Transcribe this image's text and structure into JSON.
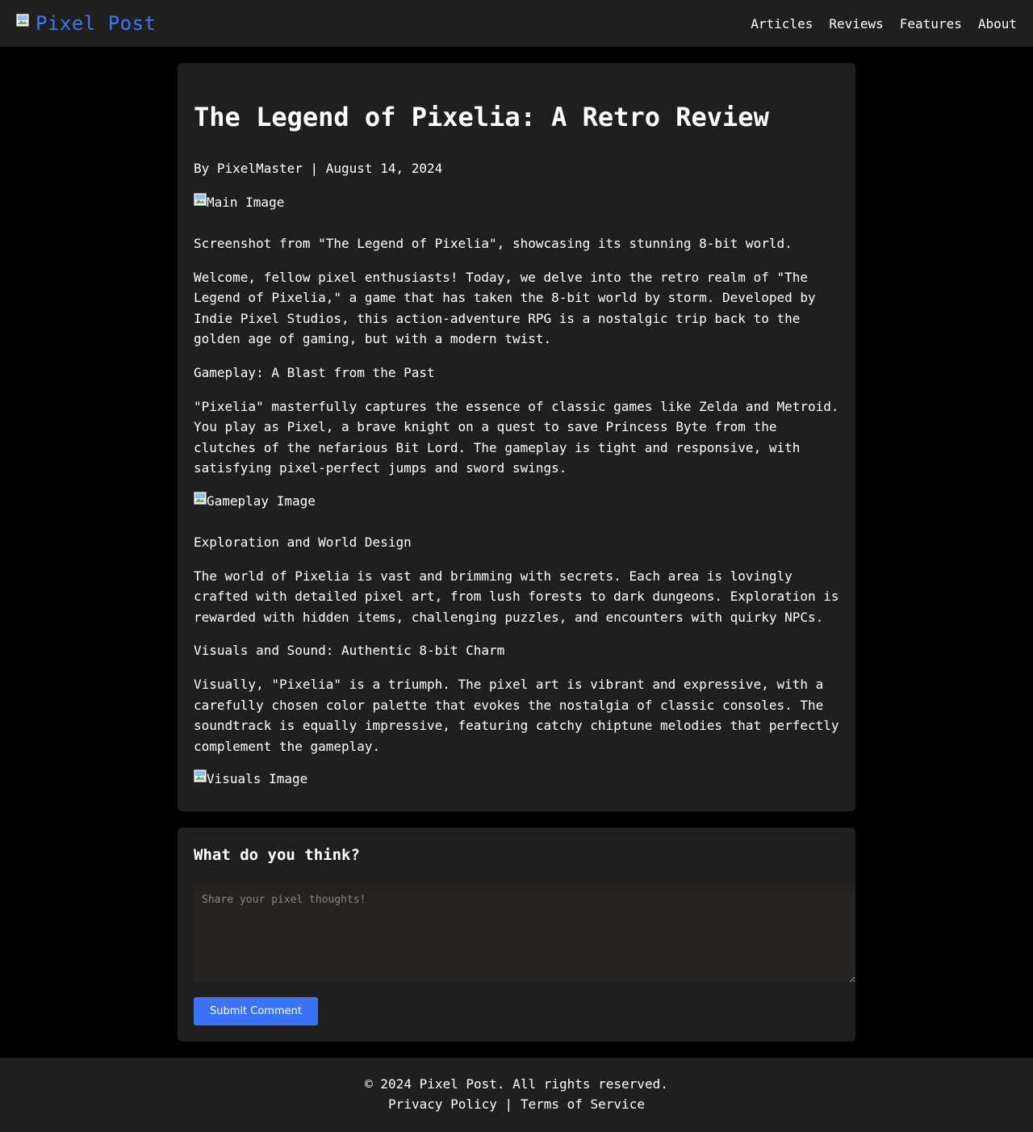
{
  "header": {
    "brand_name": "Pixel Post",
    "nav": {
      "articles": "Articles",
      "reviews": "Reviews",
      "features": "Features",
      "about": "About"
    }
  },
  "article": {
    "title": "The Legend of Pixelia: A Retro Review",
    "meta": "By PixelMaster | August 14, 2024",
    "main_image_alt": "Main Image",
    "caption": "Screenshot from \"The Legend of Pixelia\", showcasing its stunning 8-bit world.",
    "intro": "Welcome, fellow pixel enthusiasts! Today, we delve into the retro realm of \"The Legend of Pixelia,\" a game that has taken the 8-bit world by storm. Developed by Indie Pixel Studios, this action-adventure RPG is a nostalgic trip back to the golden age of gaming, but with a modern twist.",
    "gameplay_heading": "Gameplay: A Blast from the Past",
    "gameplay_text": "\"Pixelia\" masterfully captures the essence of classic games like Zelda and Metroid. You play as Pixel, a brave knight on a quest to save Princess Byte from the clutches of the nefarious Bit Lord. The gameplay is tight and responsive, with satisfying pixel-perfect jumps and sword swings.",
    "gameplay_image_alt": "Gameplay Image",
    "exploration_heading": "Exploration and World Design",
    "exploration_text": "The world of Pixelia is vast and brimming with secrets. Each area is lovingly crafted with detailed pixel art, from lush forests to dark dungeons. Exploration is rewarded with hidden items, challenging puzzles, and encounters with quirky NPCs.",
    "visuals_heading": "Visuals and Sound: Authentic 8-bit Charm",
    "visuals_text": "Visually, \"Pixelia\" is a triumph. The pixel art is vibrant and expressive, with a carefully chosen color palette that evokes the nostalgia of classic consoles. The soundtrack is equally impressive, featuring catchy chiptune melodies that perfectly complement the gameplay.",
    "visuals_image_alt": "Visuals Image"
  },
  "comments": {
    "heading": "What do you think?",
    "placeholder": "Share your pixel thoughts!",
    "submit_label": "Submit Comment"
  },
  "footer": {
    "copyright": "© 2024 Pixel Post. All rights reserved.",
    "privacy": "Privacy Policy",
    "separator": "|",
    "terms": "Terms of Service"
  },
  "colors": {
    "accent": "#3a7bf5",
    "surface": "#201f1e",
    "background": "#000000"
  }
}
